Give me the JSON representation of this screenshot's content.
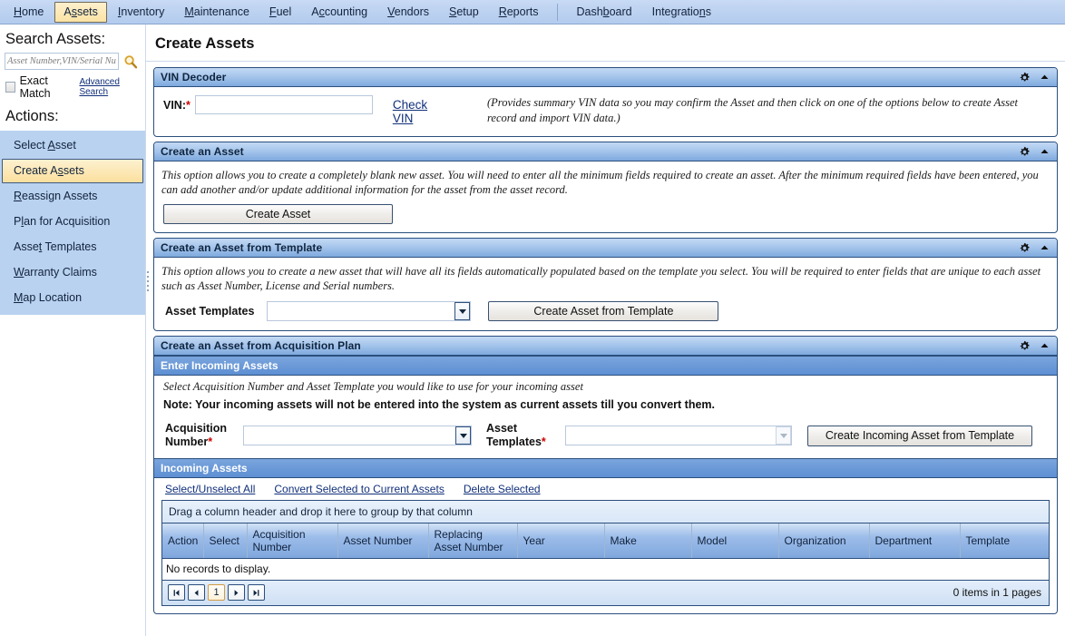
{
  "topnav": {
    "items": [
      {
        "label": "Home",
        "accel": "H",
        "active": false
      },
      {
        "label": "Assets",
        "accel": "A",
        "active": true
      },
      {
        "label": "Inventory",
        "accel": "I",
        "active": false
      },
      {
        "label": "Maintenance",
        "accel": "M",
        "active": false
      },
      {
        "label": "Fuel",
        "accel": "F",
        "active": false
      },
      {
        "label": "Accounting",
        "accel": "c",
        "active": false
      },
      {
        "label": "Vendors",
        "accel": "V",
        "active": false
      },
      {
        "label": "Setup",
        "accel": "S",
        "active": false
      },
      {
        "label": "Reports",
        "accel": "R",
        "active": false
      }
    ],
    "right_items": [
      {
        "label": "Dashboard",
        "accel": "b"
      },
      {
        "label": "Integrations",
        "accel": "n"
      }
    ]
  },
  "sidebar": {
    "search_heading": "Search Assets:",
    "search_placeholder": "Asset Number,VIN/Serial Number",
    "search_value": "",
    "search_icon": "magnifier-icon",
    "exact_match_label": "Exact Match",
    "exact_match_checked": false,
    "advanced_search_label": "Advanced Search",
    "actions_heading": "Actions:",
    "items": [
      {
        "label": "Select Asset",
        "accel": "A",
        "selected": false
      },
      {
        "label": "Create Assets",
        "accel": "s",
        "selected": true
      },
      {
        "label": "Reassign Assets",
        "accel": "R",
        "selected": false
      },
      {
        "label": "Plan for Acquisition",
        "accel": "l",
        "selected": false
      },
      {
        "label": "Asset Templates",
        "accel": "t",
        "selected": false
      },
      {
        "label": "Warranty Claims",
        "accel": "W",
        "selected": false
      },
      {
        "label": "Map Location",
        "accel": "M",
        "selected": false
      }
    ]
  },
  "page": {
    "title": "Create Assets"
  },
  "panels": {
    "vin_decoder": {
      "title": "VIN Decoder",
      "gear_icon": "gear-icon",
      "collapse_icon": "chevron-up-icon",
      "vin_label": "VIN:",
      "vin_required": "*",
      "vin_value": "",
      "check_vin_label": "Check VIN",
      "note": "(Provides summary VIN data so you may confirm the Asset and then click on one of the options below to create Asset record and import VIN data.)"
    },
    "create_asset": {
      "title": "Create an Asset",
      "gear_icon": "gear-icon",
      "collapse_icon": "chevron-up-icon",
      "description": "This option allows you to create a completely blank new asset. You will need to enter all the minimum fields required to create an asset. After the minimum required fields have been entered, you can add another and/or update additional information for the asset from the asset record.",
      "button_label": "Create Asset"
    },
    "create_from_template": {
      "title": "Create an Asset from Template",
      "gear_icon": "gear-icon",
      "collapse_icon": "chevron-up-icon",
      "description": "This option allows you to create a new asset that will have all its fields automatically populated based on the template you select. You will be required to enter fields that are unique to each asset such as Asset Number, License and Serial numbers.",
      "select_label": "Asset Templates",
      "select_value": "",
      "dropdown_icon": "chevron-down-icon",
      "button_label": "Create Asset from Template"
    },
    "acquisition_plan": {
      "title": "Create an Asset from Acquisition Plan",
      "gear_icon": "gear-icon",
      "collapse_icon": "chevron-up-icon",
      "enter_incoming": {
        "header": "Enter Incoming Assets",
        "description": "Select Acquisition Number and Asset Template you would like to use for your incoming asset",
        "note": "Note: Your incoming assets will not be entered into the system as current assets till you convert them.",
        "acq_label_line1": "Acquisition",
        "acq_label_line2": "Number",
        "acq_required": "*",
        "acq_value": "",
        "tpl_label_line1": "Asset",
        "tpl_label_line2": "Templates",
        "tpl_required": "*",
        "tpl_value": "",
        "button_label": "Create Incoming Asset from Template"
      },
      "incoming_assets": {
        "header": "Incoming Assets",
        "links": [
          "Select/Unselect All",
          "Convert Selected to Current Assets",
          "Delete Selected"
        ],
        "group_hint": "Drag a column header and drop it here to group by that column",
        "columns": [
          "Action",
          "Select",
          "Acquisition Number",
          "Asset Number",
          "Replacing Asset Number",
          "Year",
          "Make",
          "Model",
          "Organization",
          "Department",
          "Template"
        ],
        "rows": [],
        "empty_text": "No records to display.",
        "pager": {
          "first_icon": "page-first-icon",
          "prev_icon": "page-prev-icon",
          "current_page": "1",
          "next_icon": "page-next-icon",
          "last_icon": "page-last-icon",
          "info": "0 items in 1 pages"
        }
      }
    }
  },
  "colors": {
    "nav_bg": "#bcd2f0",
    "panel_border": "#2b4f7e",
    "selected_item": "#fbdf9d",
    "link": "#11307a",
    "required": "#cc0000",
    "sidebar_actions_bg": "#b9d2f0"
  }
}
